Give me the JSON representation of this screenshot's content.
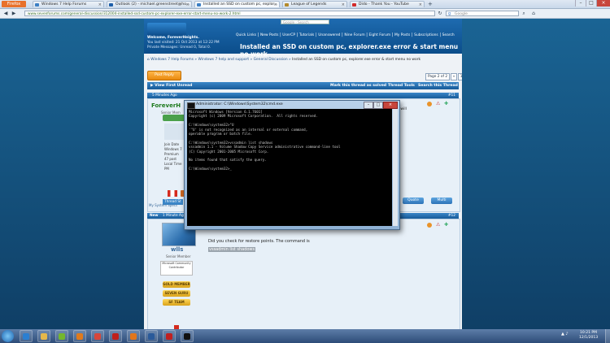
{
  "browser": {
    "menu_label": "Firefox",
    "tabs": [
      {
        "title": "Windows 7 Help Forums",
        "color": "#3c7fc4"
      },
      {
        "title": "Outlook (2) - michael.greenstreet@ho...",
        "color": "#1e5fa8"
      },
      {
        "title": "Installed an SSD on custom pc, explor...",
        "color": "#3c7fc4",
        "active": true
      },
      {
        "title": "League of Legends",
        "color": "#b48a2c"
      },
      {
        "title": "Dido - Thank You - YouTube",
        "color": "#d22a2a"
      }
    ],
    "url": "www.sevenforums.com/general-discussion/312004-installed-ssd-custom-pc-explorer-exe-error-start-menu-no-work-2.html",
    "search_placeholder": "Google",
    "google_placeholder": "Google - Search"
  },
  "forum": {
    "welcome": "Welcome, ForeverHeights.",
    "last_visited": "You last visited: 21 Oct 2013 at 12:22 PM",
    "private_messages": "Private Messages: Unread 0, Total 0.",
    "top_links": [
      "Quick Links",
      "New Posts",
      "UserCP",
      "Tutorials",
      "Unanswered",
      "Nine Forum",
      "Eight Forum",
      "My Posts",
      "Subscriptions",
      "Search"
    ],
    "page_title": "Installed an SSD on custom pc, explorer.exe error & start menu no work",
    "breadcrumb": [
      "Windows 7 Help Forums",
      "Windows 7 help and support",
      "General Discussion",
      "Installed an SSD on custom pc, explorer.exe error & start menu no work"
    ],
    "post_reply_label": "Post Reply",
    "page_of": "Page 2 of 2",
    "pages": [
      "«",
      "1",
      "2"
    ],
    "view_first_unread": "View First Unread",
    "thread_actions": [
      "Mark this thread as solved",
      "Thread Tools",
      "Search this Thread"
    ]
  },
  "post1": {
    "time": "5 Minutes Ago",
    "number": "#11",
    "username": "ForeverH",
    "rank": "Senior Mem",
    "details": [
      "Join Date",
      "Windows 7",
      "Premium",
      "47 post",
      "Local Time",
      "PM"
    ],
    "thread_starter": "Thread St",
    "signature_link": "My System Specs",
    "snippet": "ss 1 will",
    "quote_label": "Quote",
    "multi_label": "Multi"
  },
  "post2": {
    "new_label": "New",
    "time": "1 Minute Ago",
    "number": "#12",
    "username": "wlls",
    "rank": "Senior Member",
    "mvp_badge": "Microsoft Community Contributor",
    "badges": [
      "GOLD MEMBER",
      "SEVEN GURU",
      "SF TEAM"
    ],
    "text": "Did you check for restore points. The command is",
    "command": "vssadmin list shadows"
  },
  "cmd": {
    "title": "Administrator: C:\\Windows\\System32\\cmd.exe",
    "lines": [
      "Microsoft Windows [Version 6.1.7601]",
      "Copyright (c) 2009 Microsoft Corporation.  All rights reserved.",
      "",
      "C:\\Windows\\system32>\"U",
      "'\"U' is not recognized as an internal or external command,",
      "operable program or batch file.",
      "",
      "C:\\Windows\\system32>vssadmin list shadows",
      "vssadmin 1.1 - Volume Shadow Copy Service administrative command-line tool",
      "(C) Copyright 2001-2005 Microsoft Corp.",
      "",
      "No items found that satisfy the query.",
      "",
      "C:\\Windows\\system32>_"
    ]
  },
  "taskbar": {
    "time": "10:21 PM",
    "date": "12/1/2013",
    "apps": [
      {
        "name": "start-orb",
        "color": "#3a9ad9"
      },
      {
        "name": "internet-explorer",
        "color": "#2b7fd1"
      },
      {
        "name": "file-explorer",
        "color": "#e6b84a"
      },
      {
        "name": "nvidia",
        "color": "#74b72e"
      },
      {
        "name": "media-player",
        "color": "#e07a1c"
      },
      {
        "name": "chrome",
        "color": "#d8463a"
      },
      {
        "name": "acrobat",
        "color": "#c0201c"
      },
      {
        "name": "firefox",
        "color": "#e2761b"
      },
      {
        "name": "app-icon",
        "color": "#2a5a9a"
      },
      {
        "name": "error-app",
        "color": "#c02020"
      },
      {
        "name": "cmd",
        "color": "#111111"
      }
    ]
  }
}
